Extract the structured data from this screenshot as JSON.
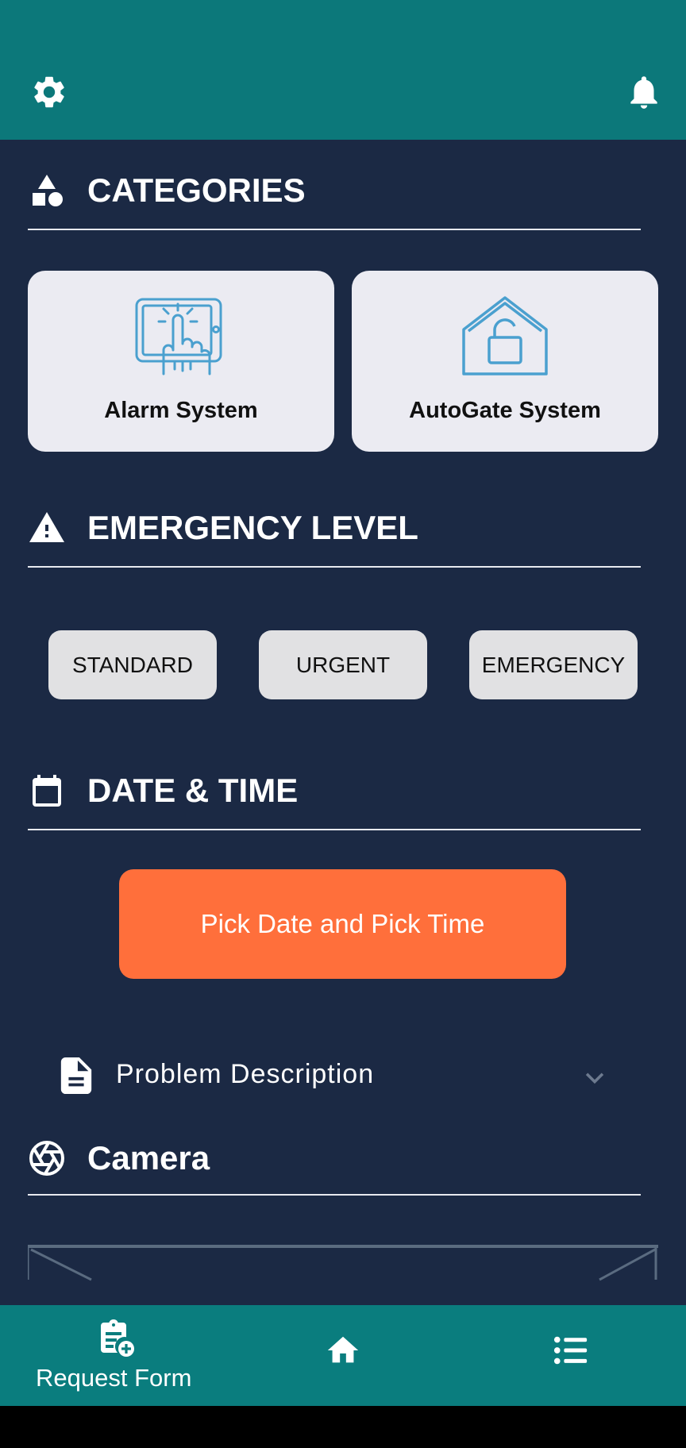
{
  "header": {
    "settings_icon": "gear-icon",
    "notifications_icon": "bell-icon"
  },
  "categories": {
    "title": "CATEGORIES",
    "icon": "shapes-icon",
    "items": [
      {
        "label": "Alarm System",
        "icon": "touch-panel-icon"
      },
      {
        "label": "AutoGate System",
        "icon": "house-lock-icon"
      }
    ]
  },
  "emergency": {
    "title": "EMERGENCY LEVEL",
    "icon": "warning-icon",
    "levels": [
      "STANDARD",
      "URGENT",
      "EMERGENCY"
    ]
  },
  "datetime": {
    "title": "DATE & TIME",
    "icon": "calendar-icon",
    "button_label": "Pick Date and Pick Time"
  },
  "problem": {
    "label": "Problem Description",
    "icon": "document-icon",
    "expand_icon": "chevron-down-icon"
  },
  "camera": {
    "title": "Camera",
    "icon": "aperture-icon"
  },
  "bottom_nav": {
    "request_form_label": "Request Form",
    "request_form_icon": "clipboard-add-icon",
    "home_icon": "home-icon",
    "list_icon": "list-icon"
  },
  "colors": {
    "header": "#0c787a",
    "background": "#1b2944",
    "accent_button": "#ff6f3b",
    "card": "#ebebf2",
    "icon_blue": "#4aa0cf"
  }
}
